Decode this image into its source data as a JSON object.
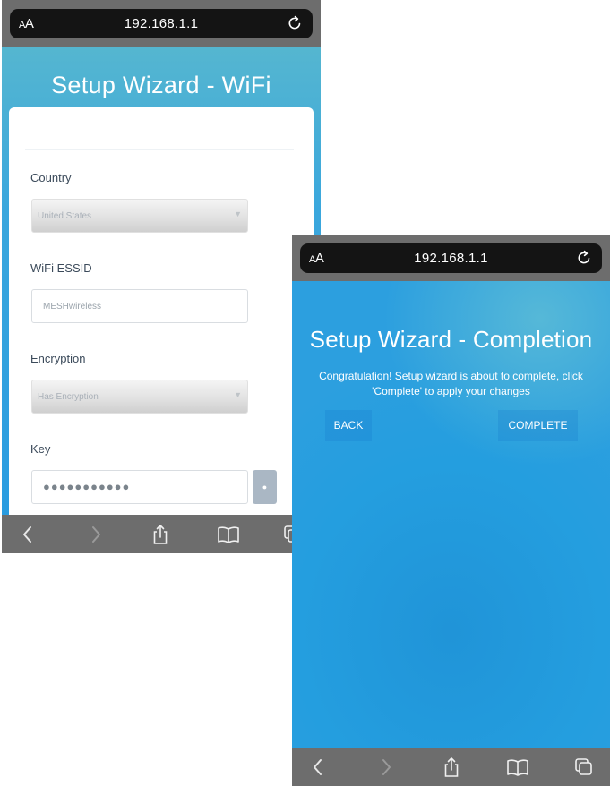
{
  "wifi_screen": {
    "url_bar": {
      "text_size_label_small": "A",
      "text_size_label_large": "A",
      "url": "192.168.1.1"
    },
    "title": "Setup Wizard - WiFi",
    "country": {
      "label": "Country",
      "value": "United States"
    },
    "essid": {
      "label": "WiFi ESSID",
      "value": "MESHwireless"
    },
    "encryption": {
      "label": "Encryption",
      "value": "Has Encryption"
    },
    "key": {
      "label": "Key",
      "value": "●●●●●●●●●●●"
    }
  },
  "completion_screen": {
    "url_bar": {
      "text_size_label_small": "A",
      "text_size_label_large": "A",
      "url": "192.168.1.1"
    },
    "title": "Setup Wizard - Completion",
    "message_line1": "Congratulation! Setup wizard is about to complete, click",
    "message_line2": "'Complete' to apply your changes",
    "back_label": "BACK",
    "complete_label": "COMPLETE"
  },
  "icons": {
    "reload": "reload-icon",
    "chevron_down": "chevron-down-icon",
    "eye": "eye-icon",
    "back": "back-arrow-icon",
    "forward": "forward-arrow-icon",
    "share": "share-icon",
    "bookmarks": "bookmarks-icon",
    "tabs": "tabs-icon"
  },
  "colors": {
    "background_top": "#55b6d0",
    "background_main": "#2a9ce0",
    "browser_chrome": "#6d6d6d",
    "url_bar": "#141414",
    "card": "#ffffff"
  }
}
